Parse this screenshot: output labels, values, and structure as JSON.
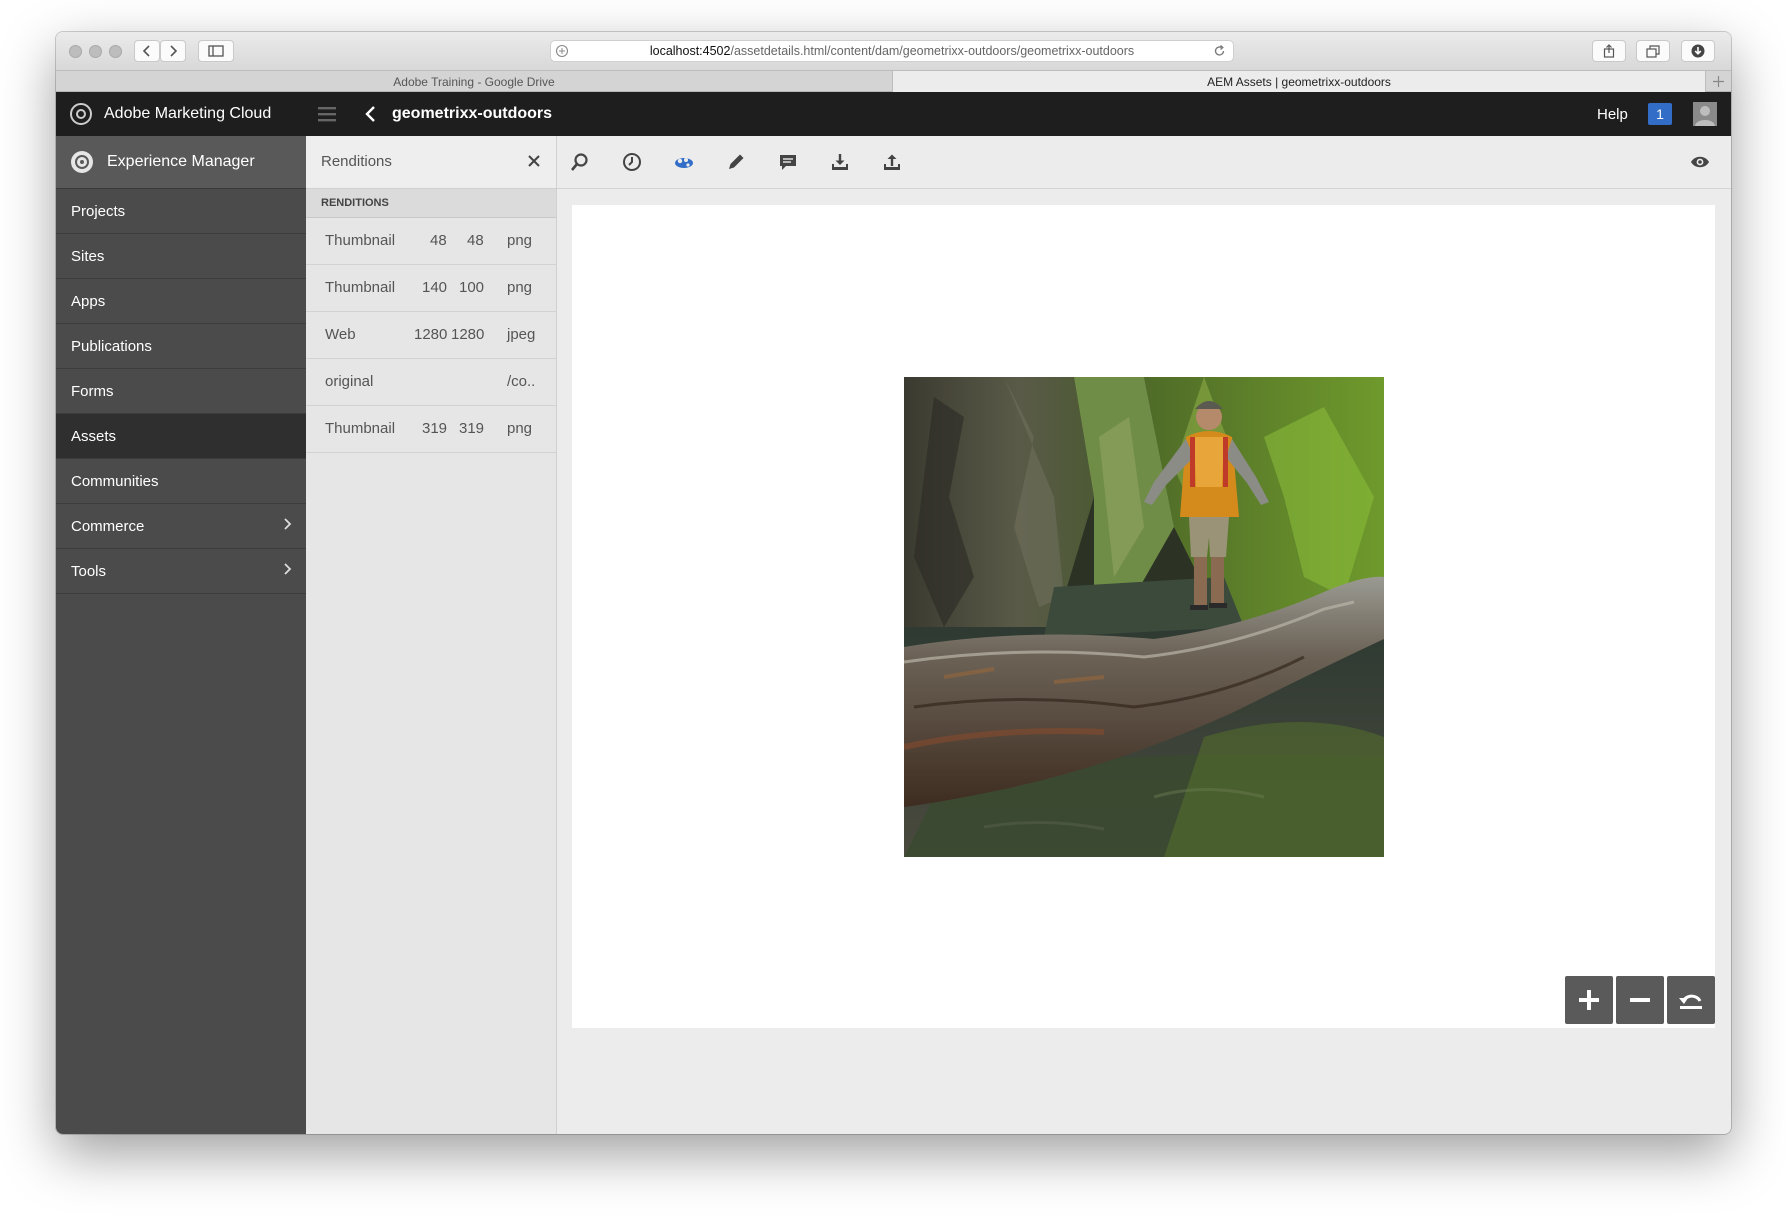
{
  "browser": {
    "address_host": "localhost:4502",
    "address_path": "/assetdetails.html/content/dam/geometrixx-outdoors/geometrixx-outdoors",
    "tabs": [
      {
        "label": "Adobe Training - Google Drive"
      },
      {
        "label": "AEM Assets | geometrixx-outdoors"
      }
    ]
  },
  "header": {
    "brand": "Adobe Marketing Cloud",
    "title": "geometrixx-outdoors",
    "help": "Help",
    "notification_count": "1"
  },
  "rail": {
    "product": "Experience Manager",
    "items": [
      {
        "label": "Projects"
      },
      {
        "label": "Sites"
      },
      {
        "label": "Apps"
      },
      {
        "label": "Publications"
      },
      {
        "label": "Forms"
      },
      {
        "label": "Assets",
        "active": true
      },
      {
        "label": "Communities"
      },
      {
        "label": "Commerce",
        "has_submenu": true
      },
      {
        "label": "Tools",
        "has_submenu": true
      }
    ]
  },
  "panel": {
    "title": "Renditions",
    "section": "RENDITIONS",
    "rows": [
      {
        "name": "Thumbnail",
        "width": "48",
        "height": "48",
        "format": "png"
      },
      {
        "name": "Thumbnail",
        "width": "140",
        "height": "100",
        "format": "png"
      },
      {
        "name": "Web",
        "width": "1280",
        "height": "1280",
        "format": "jpeg"
      },
      {
        "name": "original",
        "width": "",
        "height": "",
        "format": "/co.."
      },
      {
        "name": "Thumbnail",
        "width": "319",
        "height": "319",
        "format": "png"
      }
    ]
  },
  "toolbar": {
    "icons": [
      "search-icon",
      "timeline-icon",
      "renditions-icon",
      "edit-icon",
      "comment-icon",
      "download-icon",
      "upload-icon",
      "view-icon"
    ],
    "active_color": "#326ec8"
  },
  "colors": {
    "header_bg": "#1e1e1e",
    "rail_bg": "#4b4b4b",
    "rail_active": "#2f2f2f",
    "badge": "#326ec8"
  }
}
